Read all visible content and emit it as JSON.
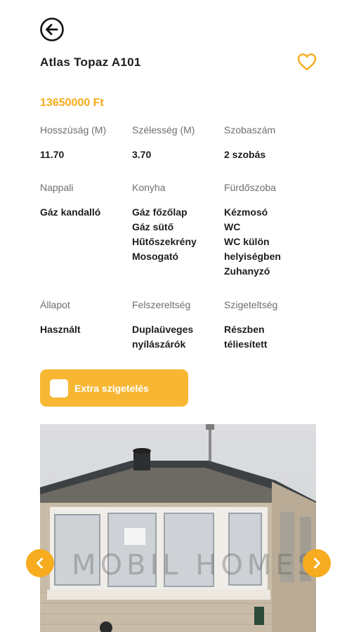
{
  "listing": {
    "title": "Atlas Topaz A101",
    "price": "13650000 Ft"
  },
  "specs": {
    "row1": [
      {
        "label": "Hosszúság (M)",
        "value": "11.70"
      },
      {
        "label": "Szélesség (M)",
        "value": "3.70"
      },
      {
        "label": "Szobaszám",
        "value": "2 szobás"
      }
    ],
    "row2": [
      {
        "label": "Nappali",
        "values": [
          "Gáz kandalló"
        ]
      },
      {
        "label": "Konyha",
        "values": [
          "Gáz főzőlap",
          "Gáz sütő",
          "Hűtőszekrény",
          "Mosogató"
        ]
      },
      {
        "label": "Fürdőszoba",
        "values": [
          "Kézmosó",
          "WC",
          "WC külön",
          "helyiségben",
          "Zuhanyzó"
        ]
      }
    ],
    "row3": [
      {
        "label": "Állapot",
        "values": [
          "Használt"
        ]
      },
      {
        "label": "Felszereltség",
        "values": [
          "Duplaüveges",
          "nyílászárók"
        ]
      },
      {
        "label": "Szigeteltség",
        "values": [
          "Részben",
          "téliesített"
        ]
      }
    ]
  },
  "extra_option": {
    "label": "Extra szigetelés",
    "checked": false
  },
  "gallery": {
    "watermark": "MOBIL HOMES"
  },
  "icons": {
    "back": "arrow-left-circle-icon",
    "favorite": "heart-outline-icon",
    "prev": "chevron-left-icon",
    "next": "chevron-right-icon"
  },
  "colors": {
    "accent": "#f7ab1f",
    "button": "#f7b733",
    "text": "#1d1d1d",
    "muted": "#6f6f6f"
  }
}
